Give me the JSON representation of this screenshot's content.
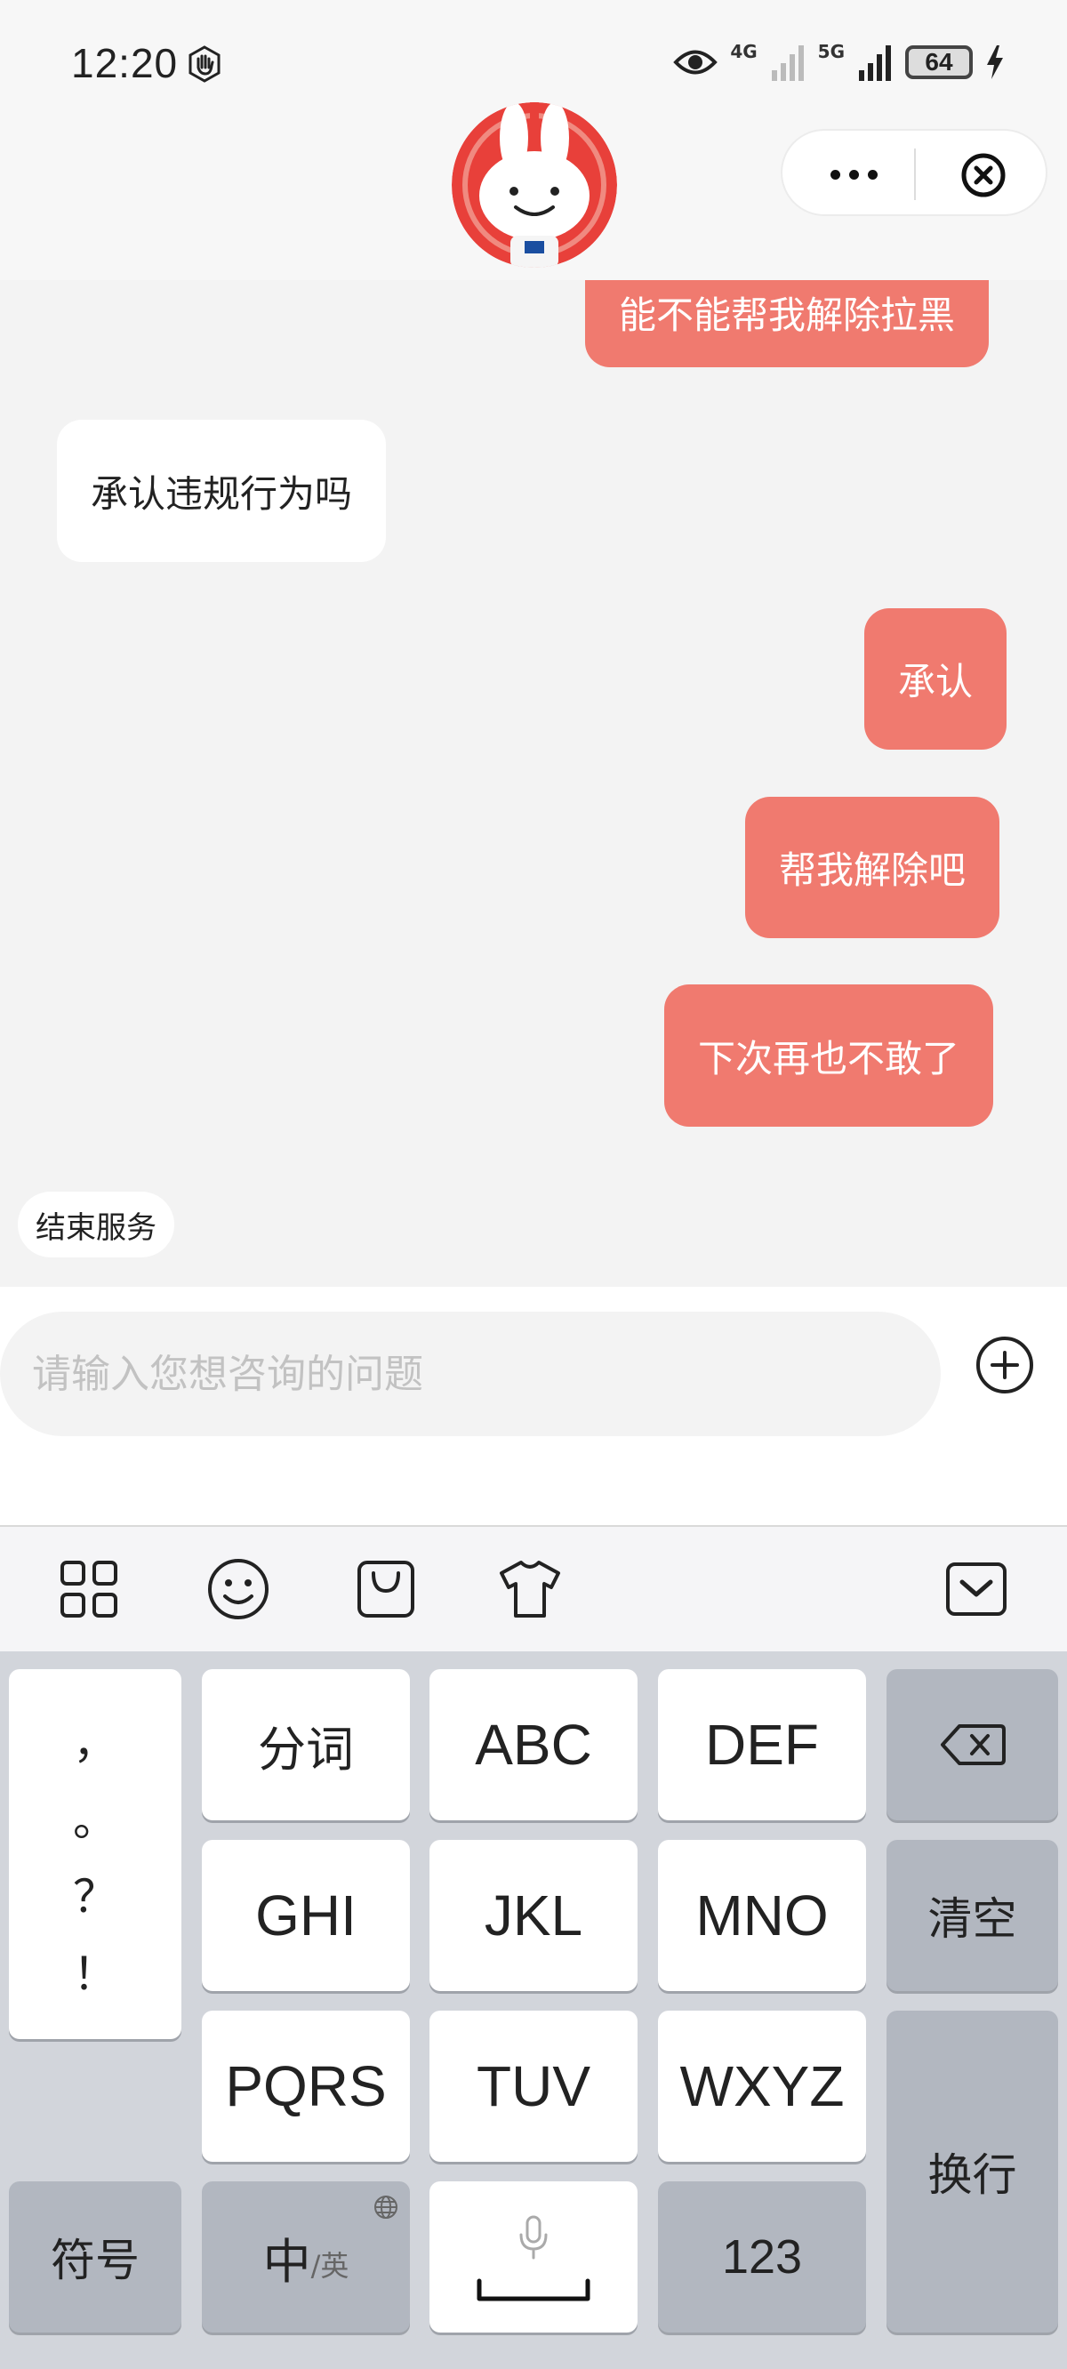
{
  "status_bar": {
    "time": "12:20",
    "net_4g": "4G",
    "net_5g": "5G",
    "battery": "64"
  },
  "chat": {
    "messages": [
      {
        "from": "me",
        "text": "能不能帮我解除拉黑"
      },
      {
        "from": "other",
        "text": "承认违规行为吗"
      },
      {
        "from": "me",
        "text": "承认"
      },
      {
        "from": "me",
        "text": "帮我解除吧"
      },
      {
        "from": "me",
        "text": "下次再也不敢了"
      }
    ],
    "end_service_label": "结束服务"
  },
  "input": {
    "placeholder": "请输入您想咨询的问题",
    "value": ""
  },
  "keyboard": {
    "punctuation": [
      "，",
      "。",
      "？",
      "！"
    ],
    "keys": {
      "fenci": "分词",
      "abc": "ABC",
      "def": "DEF",
      "ghi": "GHI",
      "jkl": "JKL",
      "mno": "MNO",
      "clear": "清空",
      "pqrs": "PQRS",
      "tuv": "TUV",
      "wxyz": "WXYZ",
      "enter": "换行",
      "symbols": "符号",
      "lang_main": "中",
      "lang_sub": "/英",
      "num": "123"
    }
  },
  "colors": {
    "my_bubble": "#f07a6f",
    "other_bubble": "#ffffff",
    "chat_bg": "#f3f3f3",
    "keyboard_bg": "#d2d5db"
  },
  "icons": [
    "hand-icon",
    "eye-icon",
    "signal-icon",
    "battery-icon",
    "charging-icon",
    "more-icon",
    "close-icon",
    "plus-icon",
    "grid-icon",
    "emoji-icon",
    "shopping-bag-icon",
    "tshirt-icon",
    "keyboard-hide-icon",
    "backspace-icon",
    "globe-icon",
    "microphone-icon"
  ]
}
